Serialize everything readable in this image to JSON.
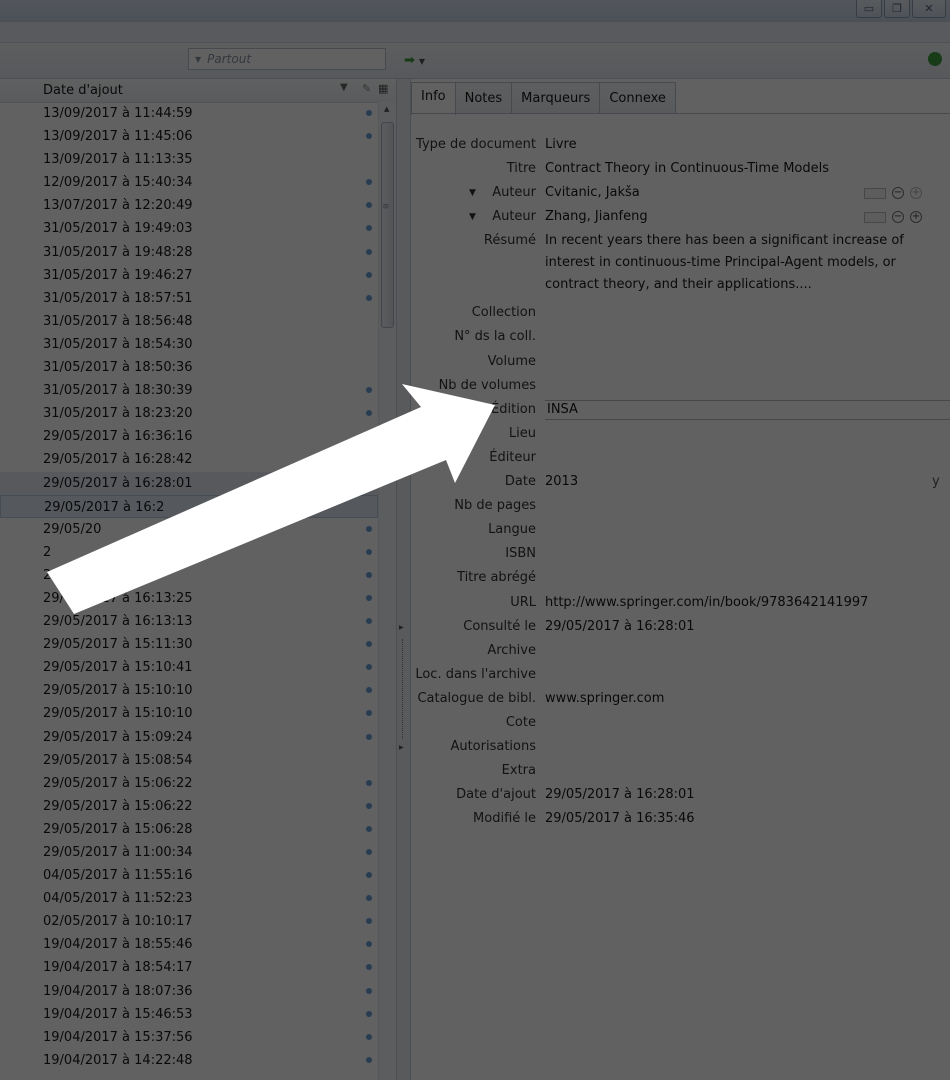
{
  "toolbar": {
    "search_scope": "Partout"
  },
  "items_list": {
    "column_date": "Date d'ajout",
    "rows": [
      {
        "date": "13/09/2017 à 11:44:59",
        "has_dot": true
      },
      {
        "date": "13/09/2017 à 11:45:06",
        "has_dot": true
      },
      {
        "date": "13/09/2017 à 11:13:35",
        "has_dot": false
      },
      {
        "date": "12/09/2017 à 15:40:34",
        "has_dot": true
      },
      {
        "date": "13/07/2017 à 12:20:49",
        "has_dot": true
      },
      {
        "date": "31/05/2017 à 19:49:03",
        "has_dot": true
      },
      {
        "date": "31/05/2017 à 19:48:28",
        "has_dot": true
      },
      {
        "date": "31/05/2017 à 19:46:27",
        "has_dot": true
      },
      {
        "date": "31/05/2017 à 18:57:51",
        "has_dot": true
      },
      {
        "date": "31/05/2017 à 18:56:48",
        "has_dot": false
      },
      {
        "date": "31/05/2017 à 18:54:30",
        "has_dot": false
      },
      {
        "date": "31/05/2017 à 18:50:36",
        "has_dot": false
      },
      {
        "date": "31/05/2017 à 18:30:39",
        "has_dot": true
      },
      {
        "date": "31/05/2017 à 18:23:20",
        "has_dot": true
      },
      {
        "date": "29/05/2017 à 16:36:16",
        "has_dot": false
      },
      {
        "date": "29/05/2017 à 16:28:42",
        "has_dot": false
      },
      {
        "date": "29/05/2017 à 16:28:01",
        "has_dot": true
      },
      {
        "date": "29/05/2017 à 16:2",
        "has_dot": false
      },
      {
        "date": "29/05/20",
        "has_dot": true
      },
      {
        "date": "2",
        "has_dot": true
      },
      {
        "date": "29/      à 16:14:38",
        "has_dot": true
      },
      {
        "date": "29/05/2017 à 16:13:25",
        "has_dot": true
      },
      {
        "date": "29/05/2017 à 16:13:13",
        "has_dot": true
      },
      {
        "date": "29/05/2017 à 15:11:30",
        "has_dot": true
      },
      {
        "date": "29/05/2017 à 15:10:41",
        "has_dot": true
      },
      {
        "date": "29/05/2017 à 15:10:10",
        "has_dot": true
      },
      {
        "date": "29/05/2017 à 15:10:10",
        "has_dot": true
      },
      {
        "date": "29/05/2017 à 15:09:24",
        "has_dot": true
      },
      {
        "date": "29/05/2017 à 15:08:54",
        "has_dot": false
      },
      {
        "date": "29/05/2017 à 15:06:22",
        "has_dot": true
      },
      {
        "date": "29/05/2017 à 15:06:22",
        "has_dot": true
      },
      {
        "date": "29/05/2017 à 15:06:28",
        "has_dot": true
      },
      {
        "date": "29/05/2017 à 11:00:34",
        "has_dot": true
      },
      {
        "date": "04/05/2017 à 11:55:16",
        "has_dot": true
      },
      {
        "date": "04/05/2017 à 11:52:23",
        "has_dot": true
      },
      {
        "date": "02/05/2017 à 10:10:17",
        "has_dot": true
      },
      {
        "date": "19/04/2017 à 18:55:46",
        "has_dot": true
      },
      {
        "date": "19/04/2017 à 18:54:17",
        "has_dot": true
      },
      {
        "date": "19/04/2017 à 18:07:36",
        "has_dot": true
      },
      {
        "date": "19/04/2017 à 15:46:53",
        "has_dot": true
      },
      {
        "date": "19/04/2017 à 15:37:56",
        "has_dot": true
      },
      {
        "date": "19/04/2017 à 14:22:48",
        "has_dot": true
      }
    ]
  },
  "tabs": [
    "Info",
    "Notes",
    "Marqueurs",
    "Connexe"
  ],
  "item": {
    "type_label": "Type de document",
    "type_value": "Livre",
    "title_label": "Titre",
    "title_value": "Contract Theory in Continuous-Time Models",
    "author_label": "Auteur",
    "author1": "Cvitanic, Jakša",
    "author2": "Zhang, Jianfeng",
    "abstract_label": "Résumé",
    "abstract_value": "In recent years there has been a significant increase of interest in continuous-time Principal-Agent models, or contract theory, and their applications....",
    "series_label": "Collection",
    "series_num_label": "N° ds la coll.",
    "volume_label": "Volume",
    "num_volumes_label": "Nb de volumes",
    "edition_label": "Édition",
    "edition_value": "INSA",
    "place_label": "Lieu",
    "publisher_label": "Éditeur",
    "date_label": "Date",
    "date_value": "2013",
    "date_format": "y",
    "pages_label": "Nb de pages",
    "language_label": "Langue",
    "isbn_label": "ISBN",
    "short_title_label": "Titre abrégé",
    "url_label": "URL",
    "url_value": "http://www.springer.com/in/book/9783642141997",
    "accessed_label": "Consulté le",
    "accessed_value": "29/05/2017 à 16:28:01",
    "archive_label": "Archive",
    "archive_loc_label": "Loc. dans l'archive",
    "catalog_label": "Catalogue de bibl.",
    "catalog_value": "www.springer.com",
    "call_number_label": "Cote",
    "rights_label": "Autorisations",
    "extra_label": "Extra",
    "date_added_label": "Date d'ajout",
    "date_added_value": "29/05/2017 à 16:28:01",
    "modified_label": "Modifié le",
    "modified_value": "29/05/2017 à 16:35:46"
  }
}
